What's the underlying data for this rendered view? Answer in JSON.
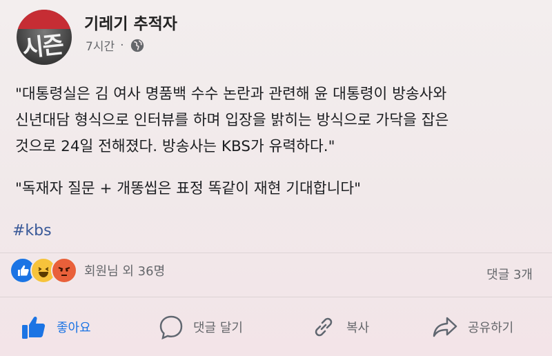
{
  "post": {
    "author": "기레기 추적자",
    "time": "7시간",
    "time_separator": "·",
    "avatar_text": "시즌",
    "text_lines": [
      "\"대통령실은 김 여사 명품백 수수 논란과 관련해 윤 대통령이 방송사와",
      "신년대담 형식으로 인터뷰를 하며 입장을 밝히는 방식으로 가닥을 잡은",
      "것으로 24일 전해졌다. 방송사는 KBS가 유력하다.\""
    ],
    "quote": "\"독재자 질문 + 개똥씹은 표정 똑같이 재현 기대합니다\"",
    "hashtag": "#kbs"
  },
  "reactions": {
    "summary": "회원님 외 36명",
    "comments": "댓글 3개",
    "types": [
      "like",
      "haha",
      "angry"
    ]
  },
  "actions": {
    "like": "좋아요",
    "comment": "댓글 달기",
    "copy": "복사",
    "share": "공유하기"
  },
  "colors": {
    "like_blue": "#1b74e4",
    "haha_yellow": "#f7c33b",
    "angry_orange": "#e9603a",
    "hashtag": "#385898",
    "secondary_text": "#65676b"
  }
}
